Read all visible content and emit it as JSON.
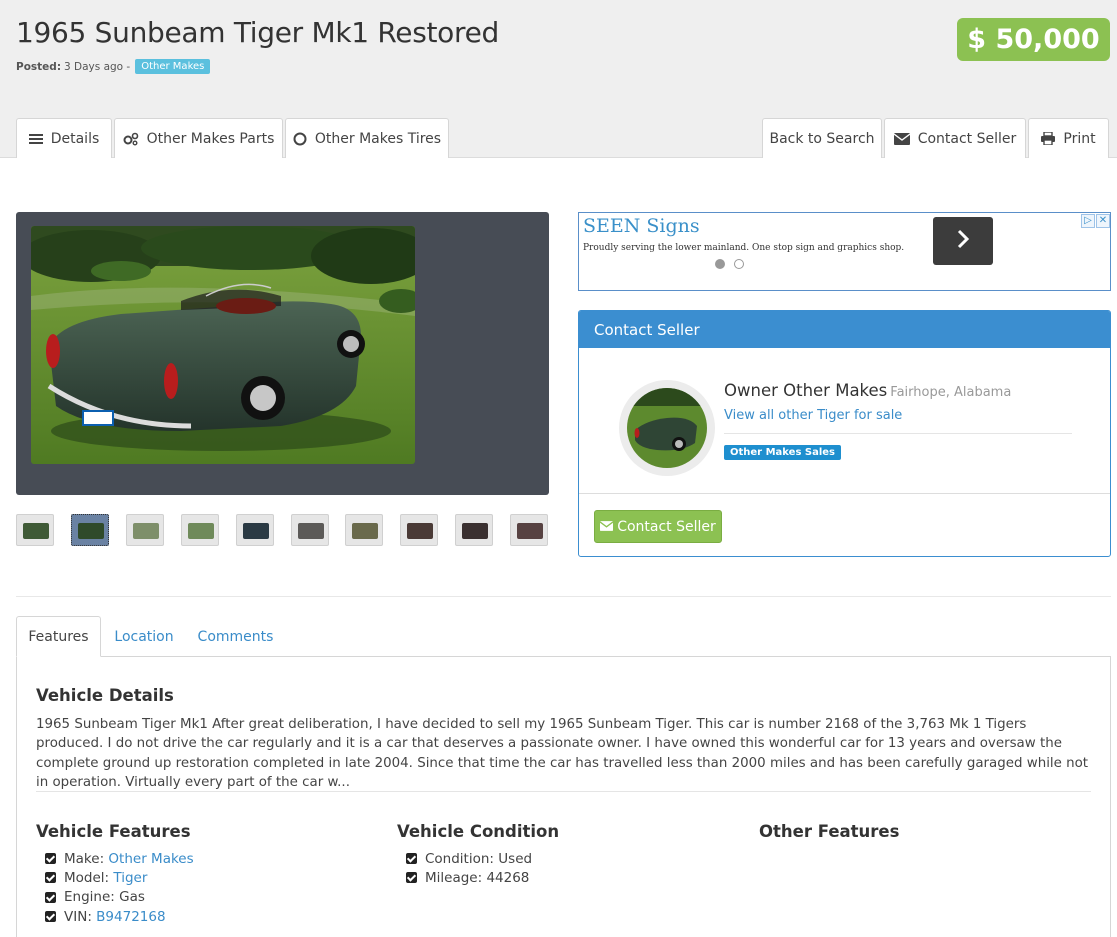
{
  "header": {
    "title": "1965 Sunbeam Tiger Mk1 Restored",
    "posted_label": "Posted:",
    "posted_value": "3 Days ago -",
    "category_tag": "Other Makes",
    "price": "$ 50,000"
  },
  "nav": {
    "details": "Details",
    "parts": "Other Makes Parts",
    "tires": "Other Makes Tires",
    "back": "Back to Search",
    "contact": "Contact Seller",
    "print": "Print"
  },
  "ad": {
    "title": "SEEN Signs",
    "text": "Proudly serving the lower mainland. One stop sign and graphics shop."
  },
  "contact_panel": {
    "heading": "Contact Seller",
    "owner": "Owner Other Makes",
    "location": "Fairhope, Alabama",
    "view_all": "View all other Tiger for sale",
    "tag": "Other Makes Sales",
    "button": "Contact Seller"
  },
  "tabs": {
    "features": "Features",
    "location": "Location",
    "comments": "Comments"
  },
  "vehicle_details": {
    "heading": "Vehicle Details",
    "description": "1965 Sunbeam Tiger Mk1 After great deliberation, I have decided to sell my 1965 Sunbeam Tiger. This car is number 2168 of the 3,763 Mk 1 Tigers produced. I do not drive the car regularly and it is a car that deserves a passionate owner. I have owned this wonderful car for 13 years and oversaw the complete ground up restoration completed in late 2004. Since that time the car has travelled less than 2000 miles and has been carefully garaged while not in operation. Virtually every part of the car w..."
  },
  "features": {
    "heading": "Vehicle Features",
    "make_label": "Make:",
    "make_value": "Other Makes",
    "model_label": "Model:",
    "model_value": "Tiger",
    "engine_label": "Engine:",
    "engine_value": "Gas",
    "vin_label": "VIN:",
    "vin_value": "B9472168"
  },
  "condition": {
    "heading": "Vehicle Condition",
    "condition_label": "Condition:",
    "condition_value": "Used",
    "mileage_label": "Mileage:",
    "mileage_value": "44268"
  },
  "other_features": {
    "heading": "Other Features"
  },
  "colors": {
    "price_green": "#8cc152",
    "panel_blue": "#3b8ed0",
    "link_blue": "#3a8cc9",
    "gallery_bg": "#474c55"
  }
}
